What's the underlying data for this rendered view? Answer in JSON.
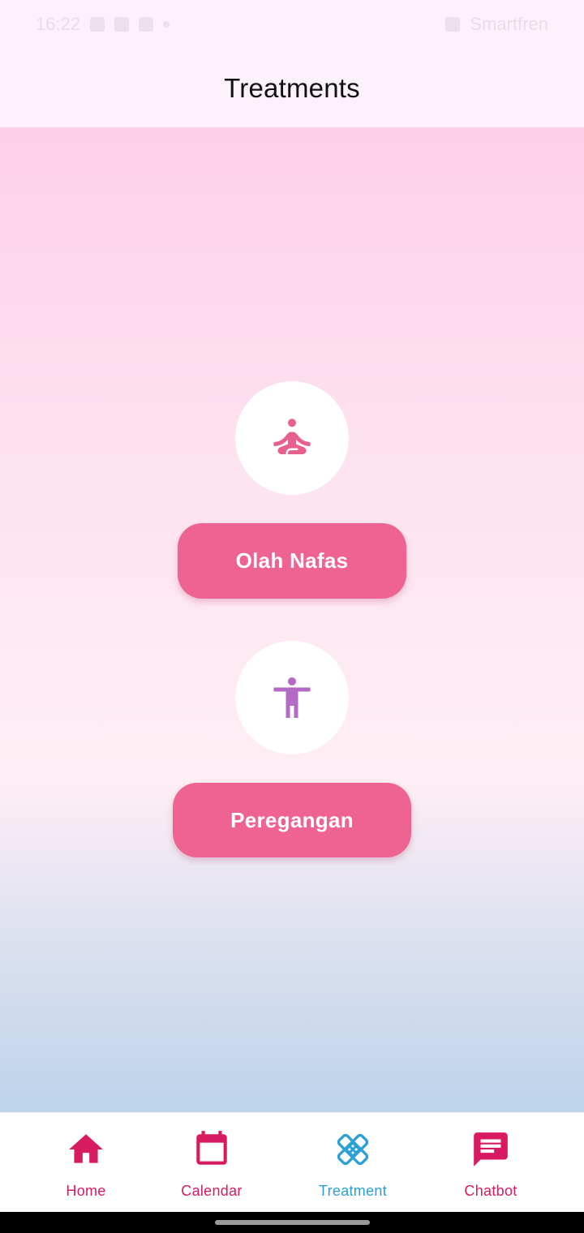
{
  "status_bar": {
    "time": "16:22",
    "right_text": "Smartfren"
  },
  "header": {
    "title": "Treatments"
  },
  "treatments": [
    {
      "label": "Olah Nafas",
      "icon": "meditation-icon",
      "icon_color": "#e8608f"
    },
    {
      "label": "Peregangan",
      "icon": "accessibility-person-icon",
      "icon_color": "#b46bc6"
    }
  ],
  "nav": {
    "active_color": "#2aa0d6",
    "inactive_color": "#d81b60",
    "items": [
      {
        "label": "Home",
        "icon": "home-icon",
        "active": false
      },
      {
        "label": "Calendar",
        "icon": "calendar-icon",
        "active": false
      },
      {
        "label": "Treatment",
        "icon": "bandage-icon",
        "active": true
      },
      {
        "label": "Chatbot",
        "icon": "chat-icon",
        "active": false
      }
    ]
  },
  "colors": {
    "button_bg": "#ee6391",
    "header_bg": "#fdf2fb",
    "gradient_top": "#fdd0e7",
    "gradient_bottom": "#bcd3ea"
  }
}
